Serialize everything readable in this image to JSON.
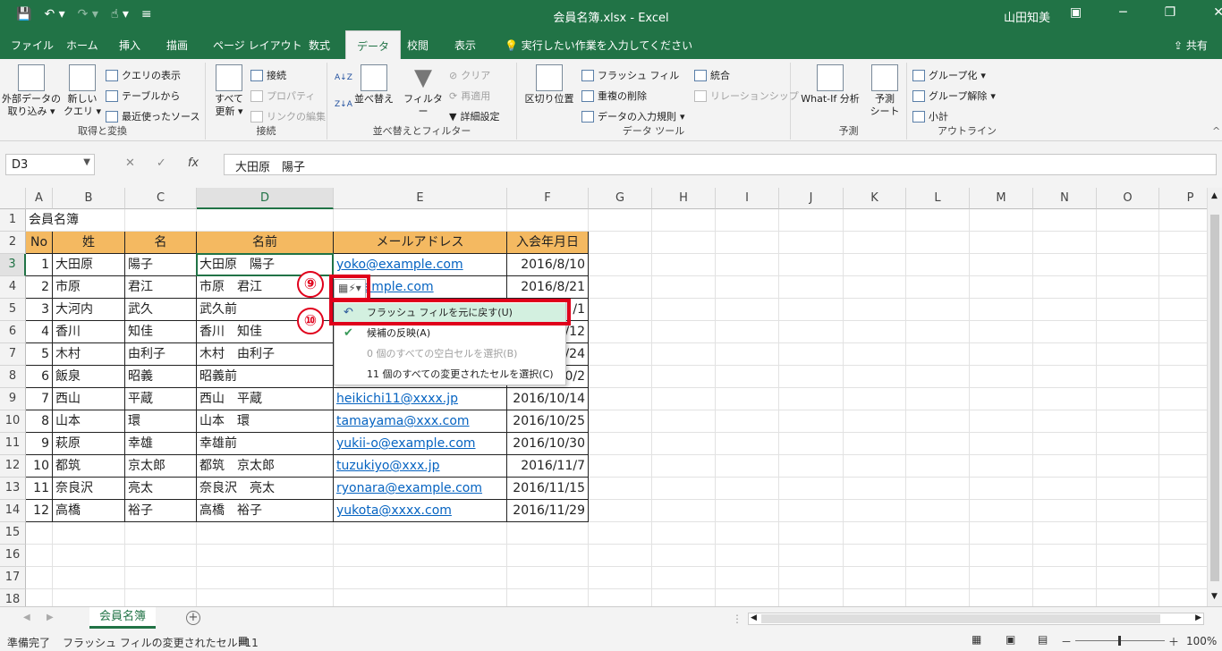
{
  "window": {
    "title": "会員名簿.xlsx  -  Excel",
    "user": "山田知美",
    "qat_icons": [
      "save-icon",
      "undo-icon",
      "redo-icon",
      "touch-mode-icon",
      "customize-icon"
    ]
  },
  "ribbon_tabs": [
    "ファイル",
    "ホーム",
    "挿入",
    "描画",
    "ページ レイアウト",
    "数式",
    "データ",
    "校閲",
    "表示"
  ],
  "active_tab": "データ",
  "tell_me": "実行したい作業を入力してください",
  "share": "共有",
  "groups": {
    "get": {
      "label": "取得と変換",
      "external": [
        "外部データの",
        "取り込み ▾"
      ],
      "newquery": [
        "新しい",
        "クエリ ▾"
      ],
      "show_query": "クエリの表示",
      "from_table": "テーブルから",
      "recent": "最近使ったソース"
    },
    "connections": {
      "label": "接続",
      "refresh": [
        "すべて",
        "更新 ▾"
      ],
      "connections": "接続",
      "properties": "プロパティ",
      "edit_links": "リンクの編集"
    },
    "sort": {
      "label": "並べ替えとフィルター",
      "sort": "並べ替え",
      "filter": "フィルター",
      "clear": "クリア",
      "reapply": "再適用",
      "advanced": "詳細設定"
    },
    "tools": {
      "label": "データ ツール",
      "text_to_col": "区切り位置",
      "flash_fill": "フラッシュ フィル",
      "remove_dup": "重複の削除",
      "validation": "データの入力規則",
      "consolidate": "統合",
      "relationships": "リレーションシップ"
    },
    "forecast": {
      "label": "予測",
      "whatif": "What-If 分析",
      "sheet": [
        "予測",
        "シート"
      ]
    },
    "outline": {
      "label": "アウトライン",
      "group": "グループ化",
      "ungroup": "グループ解除",
      "subtotal": "小計"
    }
  },
  "formula": {
    "namebox": "D3",
    "content": "大田原　陽子",
    "fx": "fx"
  },
  "columns": [
    "A",
    "B",
    "C",
    "D",
    "E",
    "F",
    "G",
    "H",
    "I",
    "J",
    "K",
    "L",
    "M",
    "N",
    "O",
    "P"
  ],
  "rows": [
    "1",
    "2",
    "3",
    "4",
    "5",
    "6",
    "7",
    "8",
    "9",
    "10",
    "11",
    "12",
    "13",
    "14",
    "15",
    "16",
    "17",
    "18"
  ],
  "sheet_title": "会員名簿",
  "table_headers": [
    "No",
    "姓",
    "名",
    "名前",
    "メールアドレス",
    "入会年月日"
  ],
  "table_rows": [
    [
      "1",
      "大田原",
      "陽子",
      "大田原　陽子",
      "yoko@example.com",
      "2016/8/10"
    ],
    [
      "2",
      "市原",
      "君江",
      "市原　君江",
      "@example.com",
      "2016/8/21"
    ],
    [
      "3",
      "大河内",
      "武久",
      "武久前",
      "",
      "/1"
    ],
    [
      "4",
      "香川",
      "知佳",
      "香川　知佳",
      "",
      "/12"
    ],
    [
      "5",
      "木村",
      "由利子",
      "木村　由利子",
      "",
      "/24"
    ],
    [
      "6",
      "飯泉",
      "昭義",
      "昭義前",
      "",
      "0/2"
    ],
    [
      "7",
      "西山",
      "平蔵",
      "西山　平蔵",
      "heikichi11@xxxx.jp",
      "2016/10/14"
    ],
    [
      "8",
      "山本",
      "環",
      "山本　環",
      "tamayama@xxx.com",
      "2016/10/25"
    ],
    [
      "9",
      "萩原",
      "幸雄",
      "幸雄前",
      "yukii-o@example.com",
      "2016/10/30"
    ],
    [
      "10",
      "都筑",
      "京太郎",
      "都筑　京太郎",
      "tuzukiyo@xxx.jp",
      "2016/11/7"
    ],
    [
      "11",
      "奈良沢",
      "亮太",
      "奈良沢　亮太",
      "ryonara@example.com",
      "2016/11/15"
    ],
    [
      "12",
      "高橋",
      "裕子",
      "高橋　裕子",
      "yukota@xxxx.com",
      "2016/11/29"
    ]
  ],
  "flash_menu": [
    {
      "label": "フラッシュ フィルを元に戻す(U)",
      "icon": "undo-icon"
    },
    {
      "label": "候補の反映(A)",
      "icon": "check-icon"
    },
    {
      "label": "0 個のすべての空白セルを選択(B)",
      "icon": ""
    },
    {
      "label": "11 個のすべての変更されたセルを選択(C)",
      "icon": ""
    }
  ],
  "callouts": [
    "⑨",
    "⑩"
  ],
  "sheet_tab": "会員名簿",
  "status": {
    "ready": "準備完了",
    "message": "フラッシュ フィルの変更されたセル: 11",
    "zoom": "100%"
  }
}
